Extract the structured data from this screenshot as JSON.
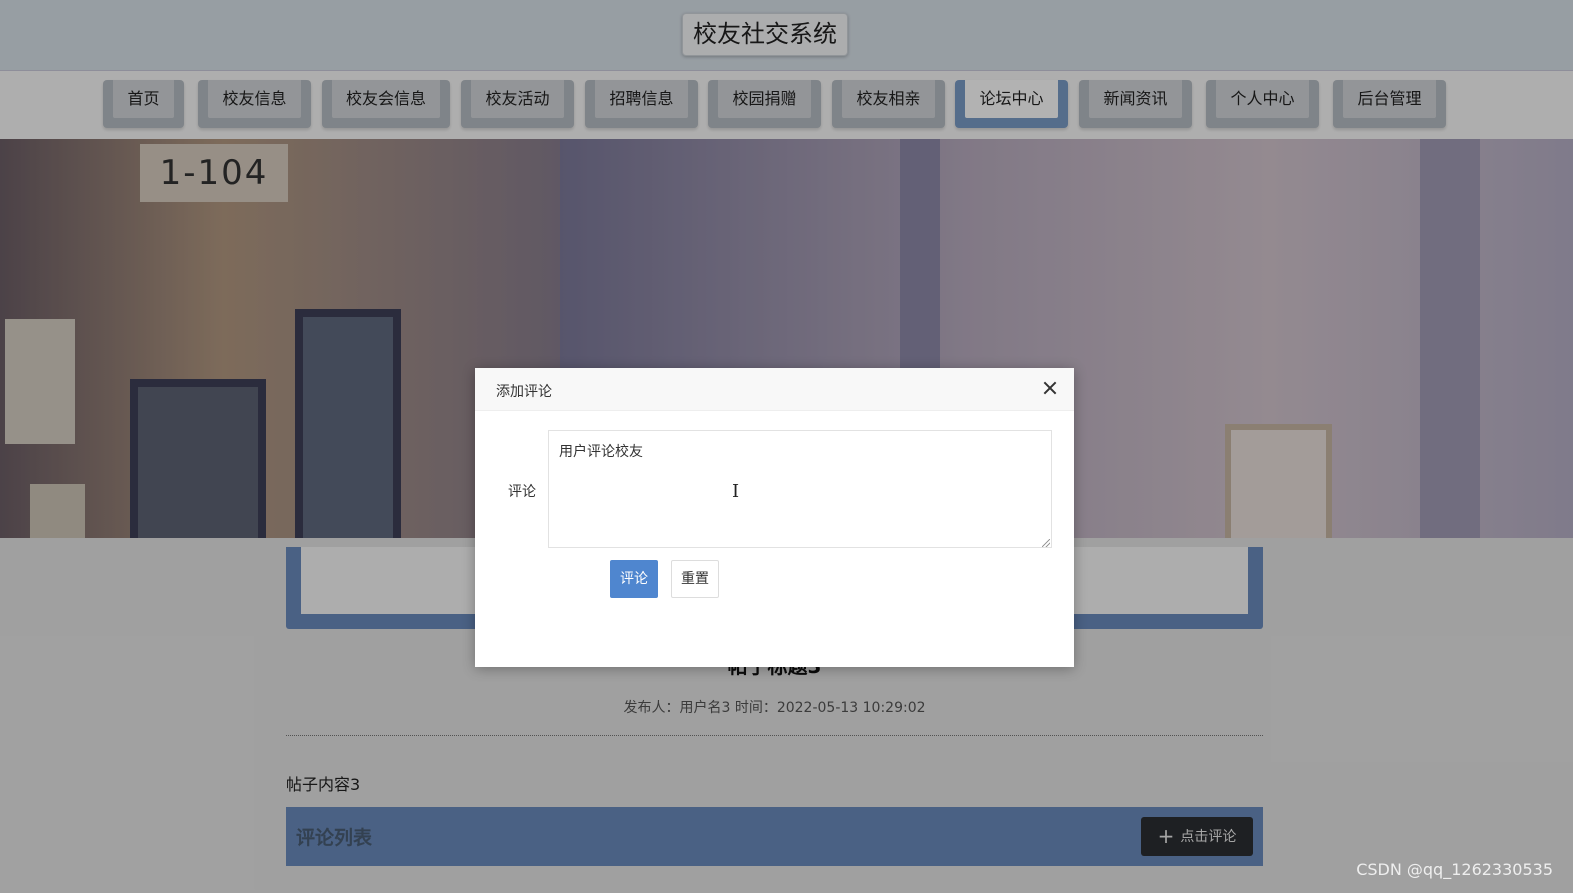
{
  "header": {
    "site_title": "校友社交系统"
  },
  "nav": {
    "items": [
      {
        "label": "首页"
      },
      {
        "label": "校友信息"
      },
      {
        "label": "校友会信息"
      },
      {
        "label": "校友活动"
      },
      {
        "label": "招聘信息"
      },
      {
        "label": "校园捐赠"
      },
      {
        "label": "校友相亲"
      },
      {
        "label": "论坛中心",
        "active": true
      },
      {
        "label": "新闻资讯"
      },
      {
        "label": "个人中心"
      },
      {
        "label": "后台管理"
      }
    ]
  },
  "banner": {
    "room_sign": "1-104"
  },
  "post": {
    "title": "帖子标题3",
    "meta": "发布人：用户名3 时间：2022-05-13 10:29:02",
    "content": "帖子内容3"
  },
  "comments": {
    "section_title": "评论列表",
    "add_button_label": "点击评论"
  },
  "modal": {
    "title": "添加评论",
    "field_label": "评论",
    "textarea_value": "用户评论校友",
    "submit_label": "评论",
    "reset_label": "重置"
  },
  "watermark": "CSDN @qq_1262330535",
  "colors": {
    "accent": "#6a8bbe",
    "primary_button": "#4f86cf",
    "active_nav": "#7a9cc8"
  }
}
